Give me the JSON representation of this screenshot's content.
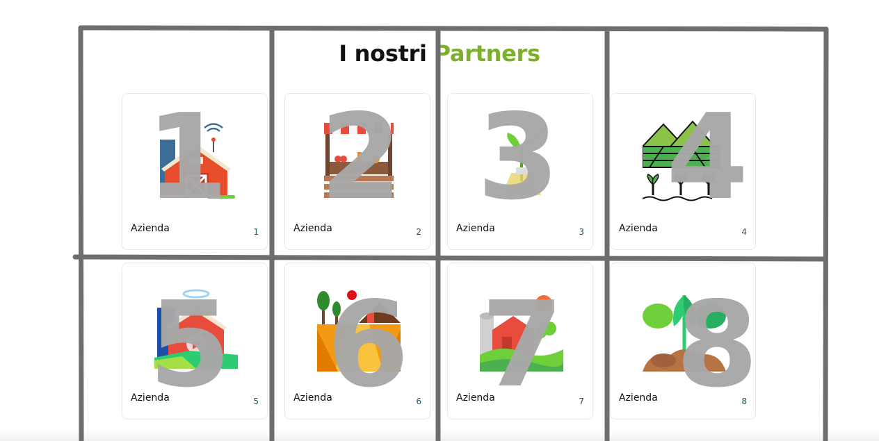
{
  "heading": {
    "part1": "I nostri ",
    "part2": "Partners"
  },
  "cards": [
    {
      "label": "Azienda",
      "index": "1",
      "icon": "barn-wifi-icon"
    },
    {
      "label": "Azienda",
      "index": "2",
      "icon": "market-stall-icon"
    },
    {
      "label": "Azienda",
      "index": "3",
      "icon": "sprout-flask-icon"
    },
    {
      "label": "Azienda",
      "index": "4",
      "icon": "fields-crops-icon"
    },
    {
      "label": "Azienda",
      "index": "5",
      "icon": "farm-video-icon"
    },
    {
      "label": "Azienda",
      "index": "6",
      "icon": "farm-landscape-icon"
    },
    {
      "label": "Azienda",
      "index": "7",
      "icon": "farm-hills-icon"
    },
    {
      "label": "Azienda",
      "index": "8",
      "icon": "plant-leaves-icon"
    }
  ],
  "overlay_labels": [
    "1",
    "2",
    "3",
    "4",
    "5",
    "6",
    "7",
    "8"
  ],
  "colors": {
    "accent": "#7cb02b",
    "index_text": "#1f5466",
    "overlay": "#a8a8a8",
    "grid_lines": "#6e6e6e"
  }
}
